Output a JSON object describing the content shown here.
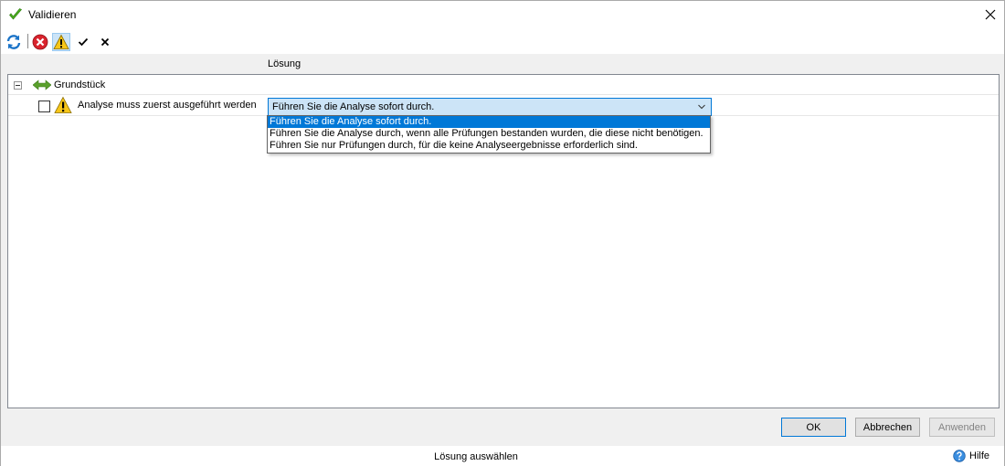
{
  "window": {
    "title": "Validieren"
  },
  "toolbar": {
    "icons": [
      "refresh-icon",
      "error-filter-icon",
      "warning-filter-icon",
      "check-all-icon",
      "uncheck-all-icon"
    ]
  },
  "grid": {
    "column_header": "Lösung",
    "group": {
      "label": "Grundstück"
    },
    "item": {
      "label": "Analyse muss zuerst ausgeführt werden",
      "selected_solution": "Führen Sie die Analyse sofort durch."
    }
  },
  "dropdown": {
    "options": [
      "Führen Sie die Analyse sofort durch.",
      "Führen Sie die Analyse durch, wenn alle Prüfungen bestanden wurden, die diese nicht benötigen.",
      "Führen Sie nur Prüfungen durch, für die keine Analyseergebnisse erforderlich sind."
    ]
  },
  "buttons": {
    "ok": "OK",
    "cancel": "Abbrechen",
    "apply": "Anwenden"
  },
  "status": {
    "text": "Lösung auswählen",
    "help_label": "Hilfe"
  },
  "colors": {
    "accent": "#0078d7",
    "selection": "#cce4f7",
    "check_green": "#4caf1e",
    "error_red": "#d9232d",
    "warning_yellow": "#f7c619"
  }
}
